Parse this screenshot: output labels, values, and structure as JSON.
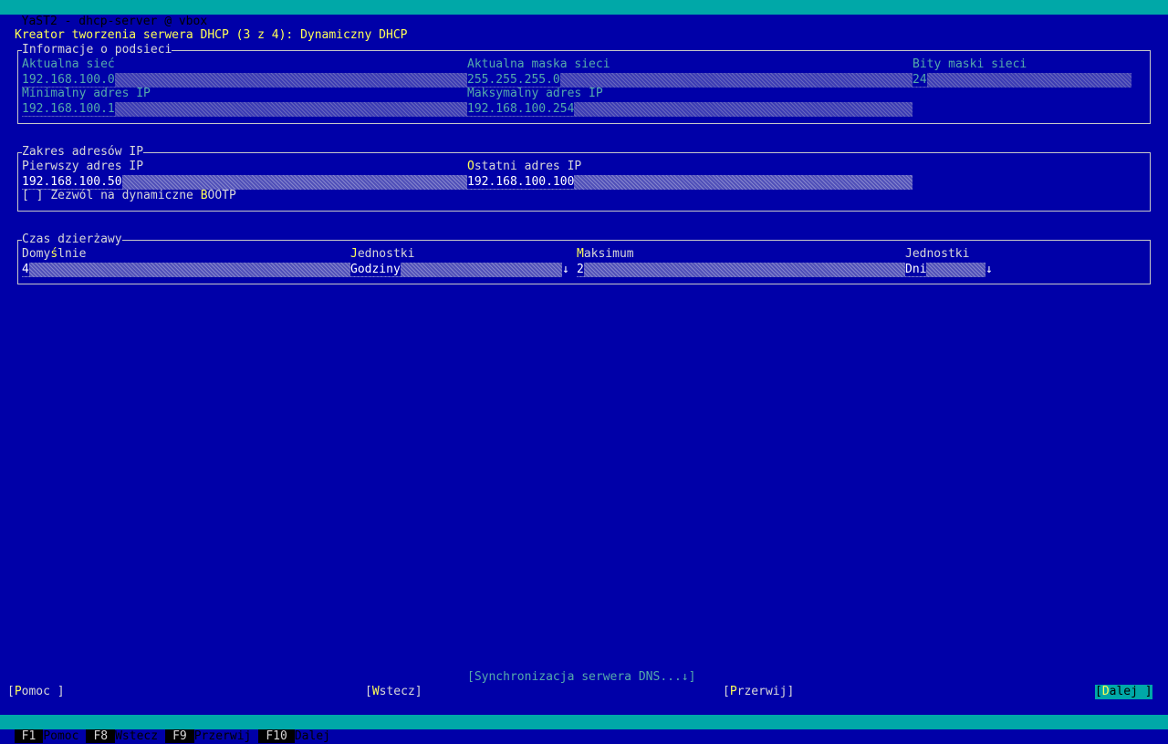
{
  "window": {
    "title": "YaST2 - dhcp-server @ vbox"
  },
  "dialog": {
    "heading": "Kreator tworzenia serwera DHCP (3 z 4): Dynamiczny DHCP"
  },
  "subnet_info": {
    "legend": "Informacje o podsieci",
    "network_label": "Aktualna sieć",
    "network_value": "192.168.100.0",
    "netmask_label": "Aktualna maska sieci",
    "netmask_value": "255.255.255.0",
    "netmask_bits_label": "Bity maski sieci",
    "netmask_bits_value": "24",
    "min_ip_label": "Minimalny adres IP",
    "min_ip_value": "192.168.100.1",
    "max_ip_label": "Maksymalny adres IP",
    "max_ip_value": "192.168.100.254"
  },
  "ip_range": {
    "legend": "Zakres adresów IP",
    "first_label_pre": "Pierwszy adres IP",
    "first_value": "192.168.100.50",
    "last_label_hot": "O",
    "last_label_rest": "statni adres IP",
    "last_value": "192.168.100.100",
    "bootp_checkbox": "[ ]",
    "bootp_label_pre": "Zezwól na dynamiczne ",
    "bootp_label_hot": "B",
    "bootp_label_post": "OOTP"
  },
  "lease": {
    "legend": "Czas dzierżawy",
    "default_label_pre": "Domy",
    "default_label_hot": "ś",
    "default_label_post": "lnie",
    "default_value": "4",
    "units1_label_hot": "J",
    "units1_label_rest": "ednostki",
    "units1_value": "Godziny",
    "max_label_hot": "M",
    "max_label_rest": "aksimum",
    "max_value": "2",
    "units2_label": "Jednostki",
    "units2_value": "Dni",
    "dropdown_arrow": "↓"
  },
  "buttons": {
    "dns_sync": "[Synchronizacja serwera DNS...↓]",
    "help_pre": "[",
    "help_hot": "P",
    "help_post": "omoc ]",
    "back_pre": "[",
    "back_hot": "W",
    "back_post": "stecz]",
    "abort_pre": "[",
    "abort_hot": "P",
    "abort_post": "rzerwij]",
    "next_pre": "[",
    "next_hot": "D",
    "next_post": "alej ]"
  },
  "fkeys": [
    {
      "key": "F1",
      "label": "Pomoc"
    },
    {
      "key": "F8",
      "label": "Wstecz"
    },
    {
      "key": "F9",
      "label": "Przerwij"
    },
    {
      "key": "F10",
      "label": "Dalej"
    }
  ],
  "colors": {
    "background": "#0000a8",
    "titlebar": "#00a8a8",
    "heading": "#ffff55",
    "label": "#55aaaa"
  }
}
